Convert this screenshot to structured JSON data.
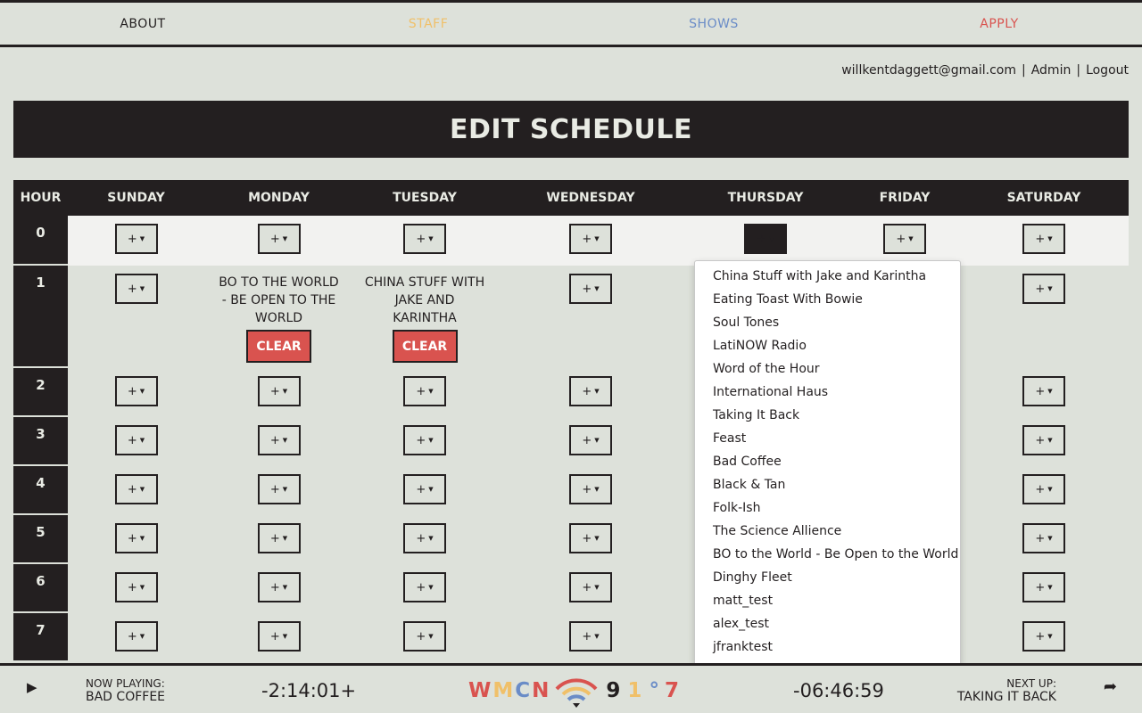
{
  "nav": {
    "items": [
      {
        "label": "ABOUT",
        "color": "#231f20"
      },
      {
        "label": "STAFF",
        "color": "#f0c069"
      },
      {
        "label": "SHOWS",
        "color": "#6a8cc7"
      },
      {
        "label": "APPLY",
        "color": "#d9534f"
      }
    ]
  },
  "user": {
    "email": "willkentdaggett@gmail.com",
    "admin": "Admin",
    "logout": "Logout",
    "sep": "|"
  },
  "page_title": "EDIT SCHEDULE",
  "schedule": {
    "headers": [
      "HOUR",
      "SUNDAY",
      "MONDAY",
      "TUESDAY",
      "WEDNESDAY",
      "THURSDAY",
      "FRIDAY",
      "SATURDAY"
    ],
    "add_label": "+",
    "clear_label": "CLEAR",
    "hours": [
      "0",
      "1",
      "2",
      "3",
      "4",
      "5",
      "6",
      "7"
    ],
    "slots": {
      "1-1": "BO TO THE WORLD - BE OPEN TO THE WORLD",
      "1-2": "CHINA STUFF WITH JAKE AND KARINTHA"
    }
  },
  "dropdown": {
    "options": [
      "China Stuff with Jake and Karintha",
      "Eating Toast With Bowie",
      "Soul Tones",
      "LatiNOW Radio",
      "Word of the Hour",
      "International Haus",
      "Taking It Back",
      "Feast",
      "Bad Coffee",
      "Black & Tan",
      "Folk-Ish",
      "The Science Allience",
      "BO to the World - Be Open to the World",
      "Dinghy Fleet",
      "matt_test",
      "alex_test",
      "jfranktest"
    ]
  },
  "player": {
    "now_playing_label": "NOW PLAYING:",
    "now_playing": "BAD COFFEE",
    "elapsed": "-2:14:01+",
    "remaining": "-06:46:59",
    "next_up_label": "NEXT UP:",
    "next_up": "TAKING IT BACK",
    "logo_letters": [
      "W",
      "M",
      "C",
      "N"
    ],
    "logo_colors": [
      "#d9534f",
      "#f0c069",
      "#6a8cc7",
      "#d9534f"
    ],
    "freq": [
      "9",
      "1",
      "°",
      "7"
    ],
    "freq_colors": [
      "#231f20",
      "#f0c069",
      "#6a8cc7",
      "#d9534f"
    ]
  }
}
